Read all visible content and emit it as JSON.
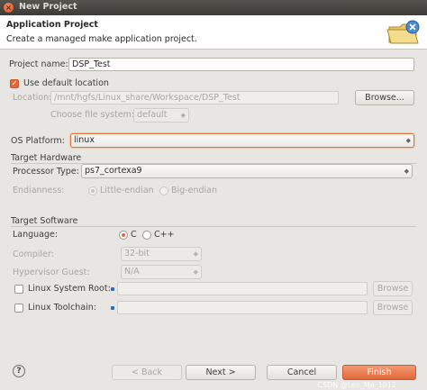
{
  "window": {
    "title": "New Project",
    "close_glyph": "×"
  },
  "header": {
    "title": "Application Project",
    "description": "Create a managed make application project.",
    "banner_icon": "folder-wizard-icon"
  },
  "project": {
    "name_label": "Project name:",
    "name_value": "DSP_Test",
    "use_default_label": "Use default location",
    "use_default_checked": true,
    "location_label": "Location:",
    "location_value": "/mnt/hgfs/Linux_share/Workspace/DSP_Test",
    "browse_label": "Browse...",
    "filesystem_label": "Choose file system:",
    "filesystem_value": "default"
  },
  "os": {
    "label": "OS Platform:",
    "value": "linux"
  },
  "hardware": {
    "group_title": "Target Hardware",
    "processor_label": "Processor Type:",
    "processor_value": "ps7_cortexa9",
    "endianness_label": "Endianness:",
    "little_endian_label": "Little-endian",
    "big_endian_label": "Big-endian",
    "endianness_selected": "little"
  },
  "software": {
    "group_title": "Target Software",
    "language_label": "Language:",
    "lang_c_label": "C",
    "lang_cpp_label": "C++",
    "language_selected": "C",
    "compiler_label": "Compiler:",
    "compiler_value": "32-bit",
    "hypervisor_label": "Hypervisor Guest:",
    "hypervisor_value": "N/A",
    "sysroot_label": "Linux System Root:",
    "sysroot_value": "",
    "toolchain_label": "Linux Toolchain:",
    "toolchain_value": "",
    "browse_label": "Browse"
  },
  "footer": {
    "help_glyph": "?",
    "back_label": "< Back",
    "next_label": "Next >",
    "cancel_label": "Cancel",
    "finish_label": "Finish",
    "watermark": "CSDN @Leo_Ma_1012"
  },
  "colors": {
    "accent": "#e2683b",
    "titlebar": "#3c3b37",
    "background": "#e8e6e2"
  }
}
